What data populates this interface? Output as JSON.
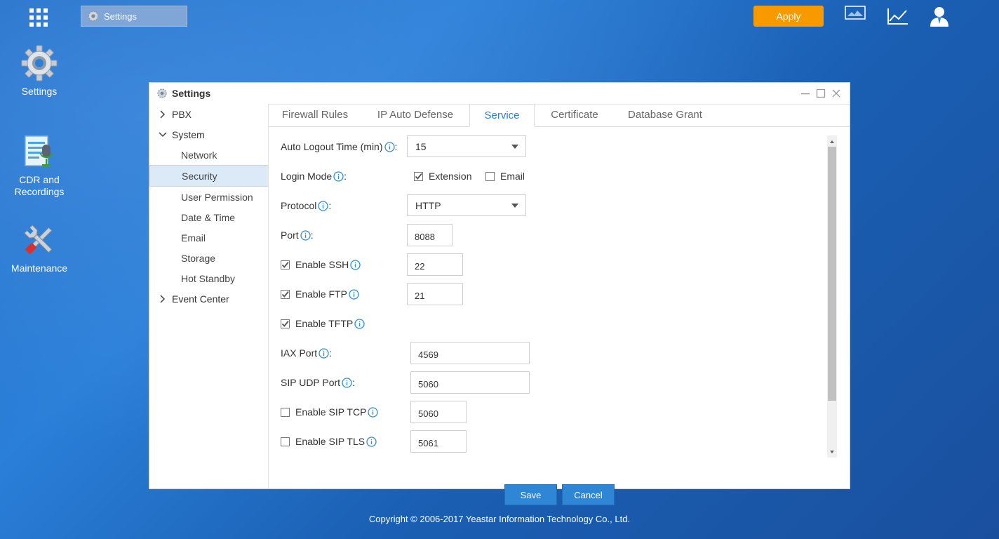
{
  "taskbar": {
    "open_window_label": "Settings",
    "apply_label": "Apply"
  },
  "desktop": {
    "icons": [
      {
        "label": "Settings"
      },
      {
        "label": "CDR and Recordings"
      },
      {
        "label": "Maintenance"
      }
    ]
  },
  "window": {
    "title": "Settings"
  },
  "sidebar": {
    "pbx": "PBX",
    "system": "System",
    "system_items": [
      "Network",
      "Security",
      "User Permission",
      "Date & Time",
      "Email",
      "Storage",
      "Hot Standby"
    ],
    "active_item": "Security",
    "event_center": "Event Center"
  },
  "tabs": [
    "Firewall Rules",
    "IP Auto Defense",
    "Service",
    "Certificate",
    "Database Grant"
  ],
  "active_tab": "Service",
  "form": {
    "auto_logout_label": "Auto Logout Time (min)",
    "auto_logout_value": "15",
    "login_mode_label": "Login Mode",
    "login_mode_extension": "Extension",
    "login_mode_extension_checked": true,
    "login_mode_email": "Email",
    "login_mode_email_checked": false,
    "protocol_label": "Protocol",
    "protocol_value": "HTTP",
    "port_label": "Port",
    "port_value": "8088",
    "ssh_label": "Enable SSH",
    "ssh_checked": true,
    "ssh_value": "22",
    "ftp_label": "Enable FTP",
    "ftp_checked": true,
    "ftp_value": "21",
    "tftp_label": "Enable TFTP",
    "tftp_checked": true,
    "iax_port_label": "IAX Port",
    "iax_port_value": "4569",
    "sip_udp_label": "SIP UDP Port",
    "sip_udp_value": "5060",
    "sip_tcp_label": "Enable SIP TCP",
    "sip_tcp_checked": false,
    "sip_tcp_value": "5060",
    "sip_tls_label": "Enable SIP TLS",
    "sip_tls_checked": false,
    "sip_tls_value": "5061",
    "colon": ":"
  },
  "buttons": {
    "save": "Save",
    "cancel": "Cancel"
  },
  "footer": {
    "copyright": "Copyright © 2006-2017 Yeastar Information Technology Co., Ltd."
  },
  "colors": {
    "apply": "#f79a00",
    "primary_button": "#2f86d4",
    "active_tab_text": "#2c7ec9",
    "info_icon": "#2c8fd6"
  }
}
